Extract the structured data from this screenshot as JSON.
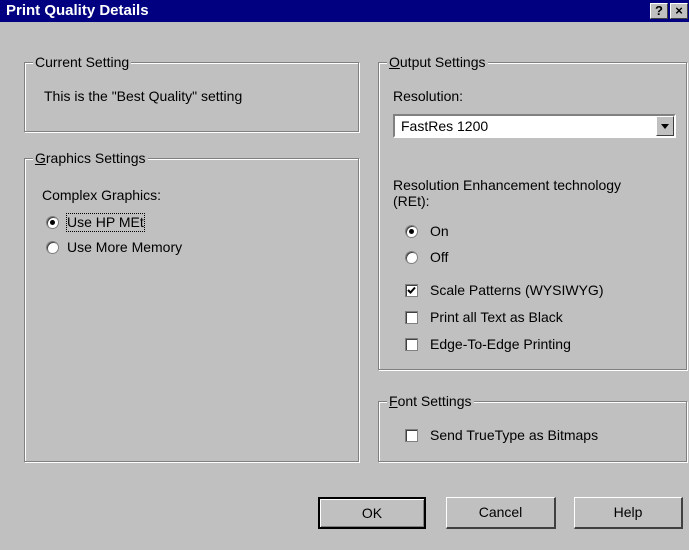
{
  "window": {
    "title": "Print Quality Details",
    "help_glyph": "?",
    "close_glyph": "×"
  },
  "current_setting": {
    "legend": "Current Setting",
    "text": "This is the \"Best Quality\" setting"
  },
  "graphics_settings": {
    "legend_accel": "G",
    "legend_rest": "raphics Settings",
    "complex_label": "Complex Graphics:",
    "options": [
      {
        "label": "Use HP MEt",
        "selected": true
      },
      {
        "label": "Use More Memory",
        "selected": false
      }
    ]
  },
  "output_settings": {
    "legend_accel": "O",
    "legend_rest": "utput Settings",
    "resolution_label": "Resolution:",
    "resolution_value": "FastRes 1200",
    "ret_label_line1": "Resolution Enhancement technology",
    "ret_label_line2": "(REt):",
    "ret_options": [
      {
        "label": "On",
        "selected": true
      },
      {
        "label": "Off",
        "selected": false
      }
    ],
    "checkboxes": [
      {
        "label": "Scale Patterns (WYSIWYG)",
        "checked": true
      },
      {
        "label": "Print all Text as Black",
        "checked": false
      },
      {
        "label": "Edge-To-Edge Printing",
        "checked": false
      }
    ]
  },
  "font_settings": {
    "legend_accel": "F",
    "legend_rest": "ont Settings",
    "checkbox": {
      "label": "Send TrueType as Bitmaps",
      "checked": false
    }
  },
  "buttons": {
    "ok": "OK",
    "cancel": "Cancel",
    "help": "Help"
  }
}
